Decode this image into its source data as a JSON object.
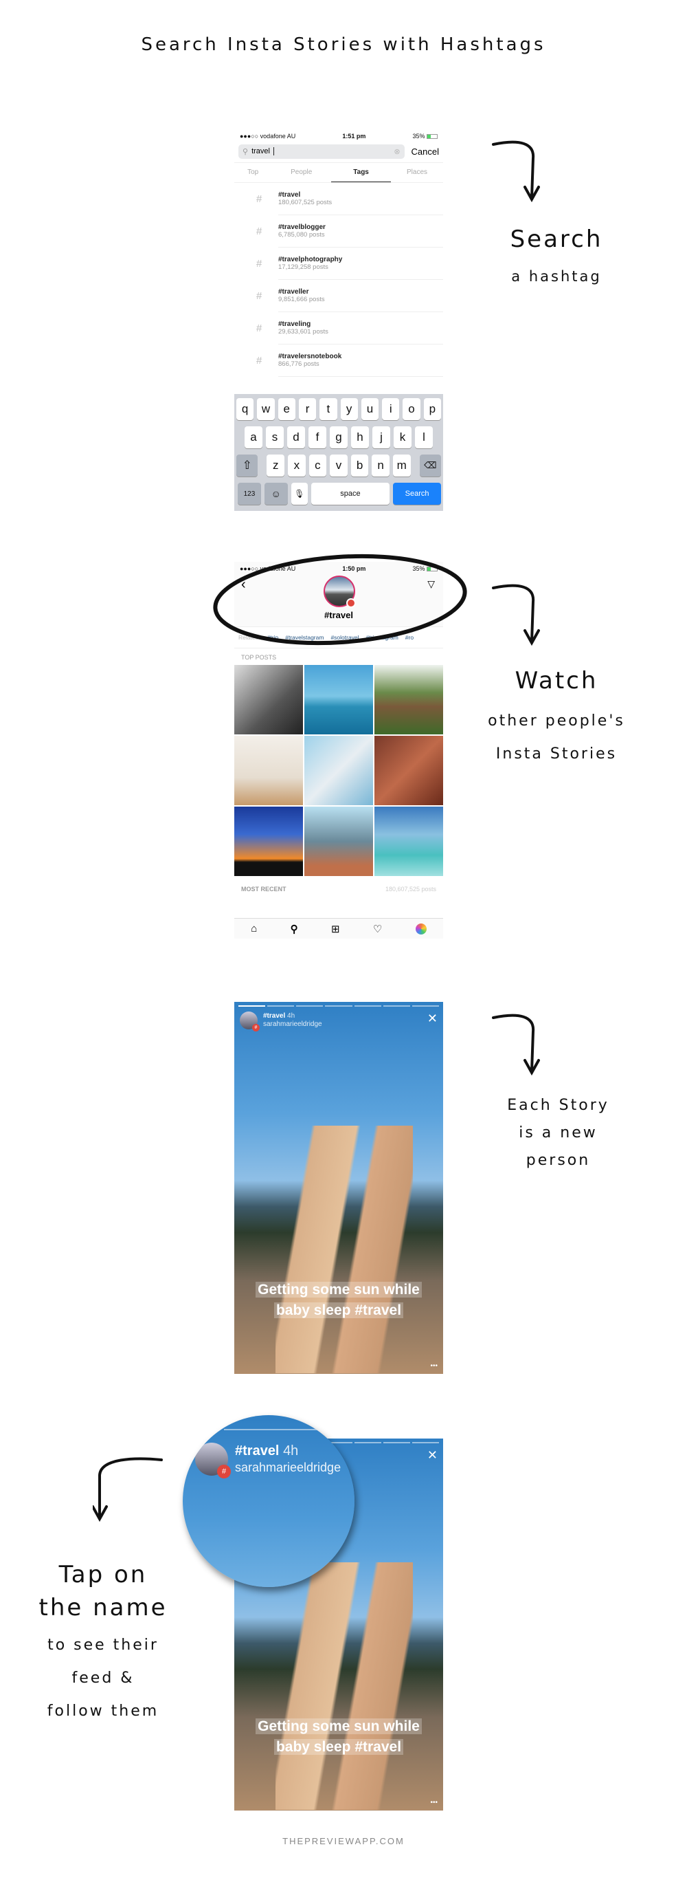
{
  "title": "Search Insta Stories with Hashtags",
  "step1": {
    "heading": "Search",
    "sub": "a hashtag"
  },
  "step2": {
    "heading": "Watch",
    "sub1": "other people's",
    "sub2": "Insta Stories"
  },
  "step3": {
    "line1": "Each Story",
    "line2": "is a new",
    "line3": "person"
  },
  "step4": {
    "line1": "Tap on",
    "line2": "the name",
    "line3": "to see their",
    "line4": "feed &",
    "line5": "follow them"
  },
  "footer": "THEPREVIEWAPP.COM",
  "screen1": {
    "status": {
      "carrier": "●●●○○ vodafone AU",
      "time": "1:51 pm",
      "battery": "35%"
    },
    "search_value": "travel",
    "cancel": "Cancel",
    "tabs": [
      "Top",
      "People",
      "Tags",
      "Places"
    ],
    "active_tab": "Tags",
    "results": [
      {
        "tag": "#travel",
        "count": "180,607,525 posts"
      },
      {
        "tag": "#travelblogger",
        "count": "6,785,080 posts"
      },
      {
        "tag": "#travelphotography",
        "count": "17,129,258 posts"
      },
      {
        "tag": "#traveller",
        "count": "9,851,666 posts"
      },
      {
        "tag": "#traveling",
        "count": "29,633,601 posts"
      },
      {
        "tag": "#travelersnotebook",
        "count": "866,776 posts"
      }
    ],
    "keyboard": {
      "row1": [
        "q",
        "w",
        "e",
        "r",
        "t",
        "y",
        "u",
        "i",
        "o",
        "p"
      ],
      "row2": [
        "a",
        "s",
        "d",
        "f",
        "g",
        "h",
        "j",
        "k",
        "l"
      ],
      "row3": [
        "z",
        "x",
        "c",
        "v",
        "b",
        "n",
        "m"
      ],
      "num": "123",
      "space": "space",
      "search": "Search"
    },
    "search_color": "#1a82fb"
  },
  "screen2": {
    "status": {
      "carrier": "●●●○○ vodafone AU",
      "time": "1:50 pm",
      "battery": "35%"
    },
    "hashtag": "#travel",
    "related_label": "Related:",
    "related": [
      "#trip",
      "#travelstagram",
      "#solotravel",
      "#tripstagram",
      "#ro"
    ],
    "top_posts": "TOP POSTS",
    "most_recent": "MOST RECENT",
    "count": "180,607,525 posts",
    "link_color": "#2a5885"
  },
  "story": {
    "tag": "#travel",
    "age": "4h",
    "user": "sarahmarieeldridge",
    "caption1": "Getting some sun while",
    "caption2": "baby sleep #travel"
  }
}
